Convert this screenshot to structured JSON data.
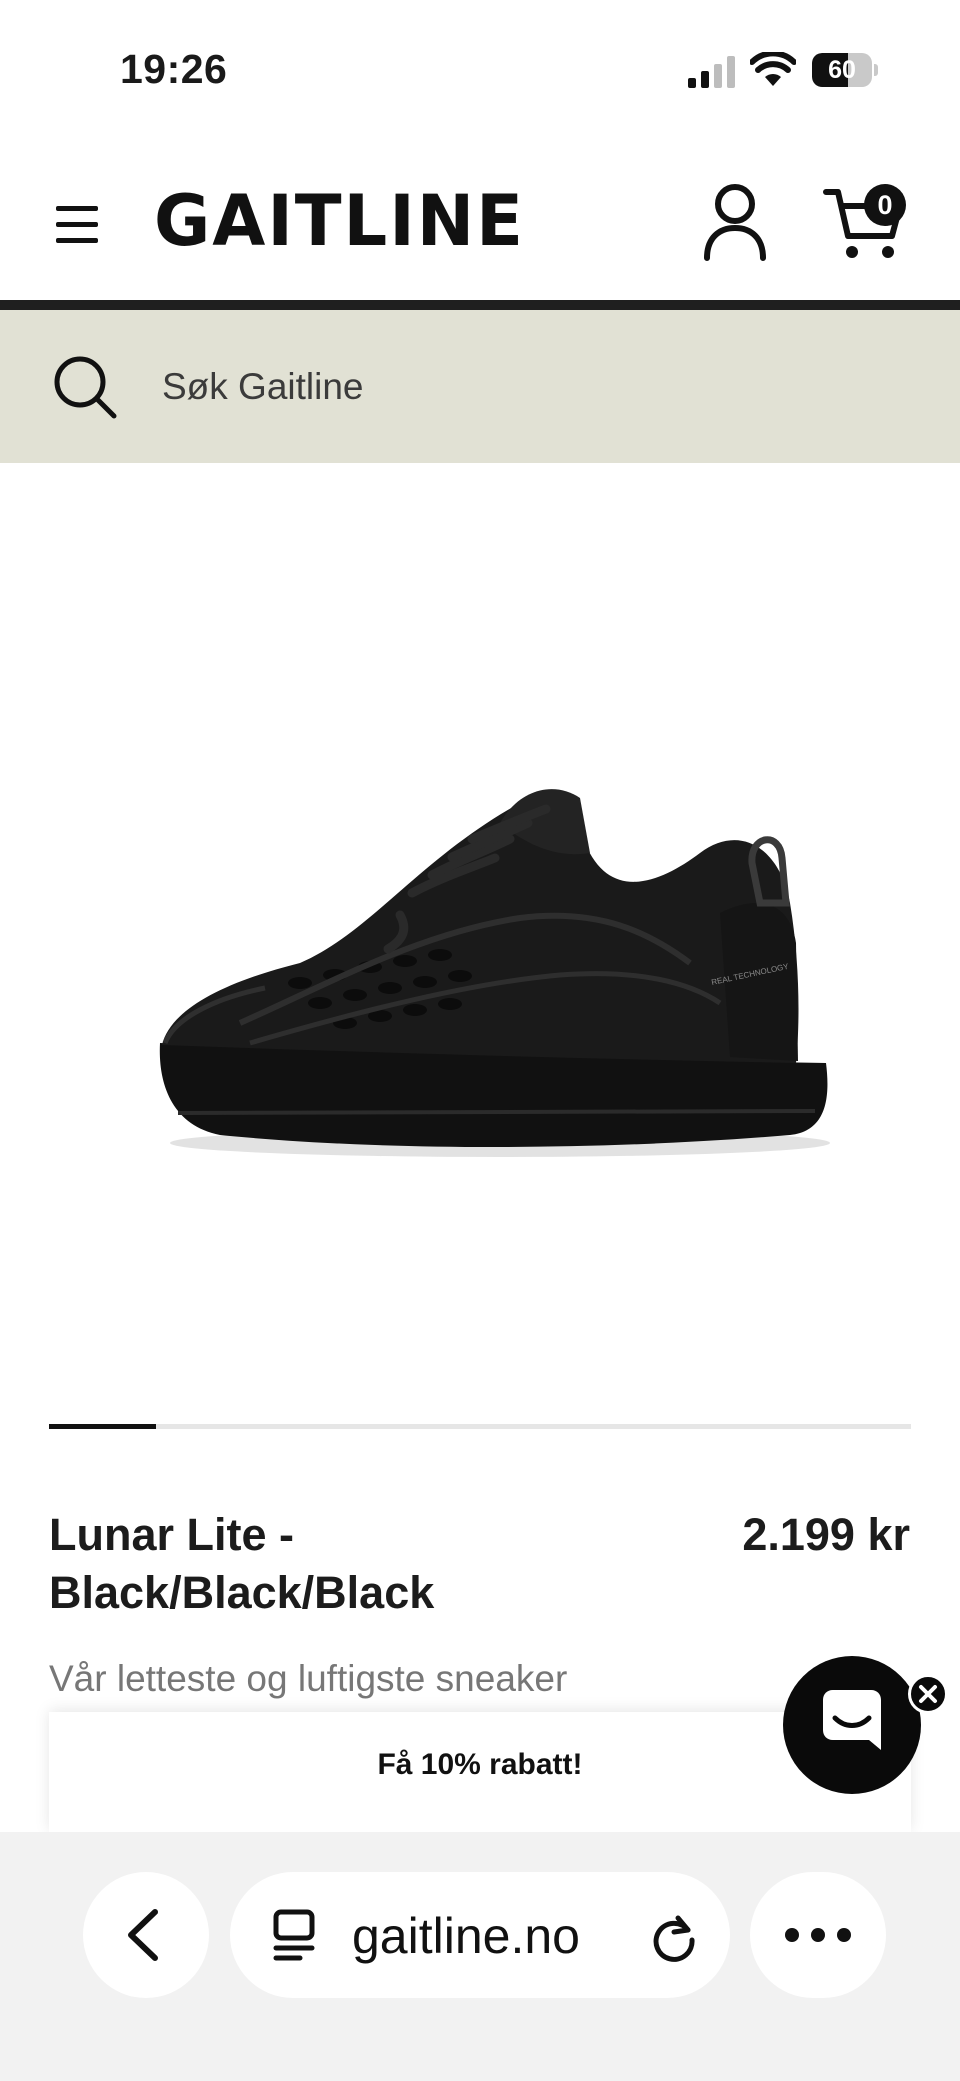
{
  "status_bar": {
    "time": "19:26",
    "battery_percent": "60",
    "battery_level": 0.6
  },
  "header": {
    "logo": "GAITLINE",
    "cart_count": "0"
  },
  "search": {
    "placeholder": "Søk Gaitline"
  },
  "gallery": {
    "progress_fraction": 0.124
  },
  "product": {
    "title": "Lunar Lite - Black/Black/Black",
    "price": "2.199 kr",
    "tagline": "Vår letteste og luftigste sneaker",
    "heel_tab_print": "REAL TECHNOLOGY"
  },
  "discount_banner": {
    "label": "Få 10% rabatt!"
  },
  "browser": {
    "url": "gaitline.no"
  },
  "colors": {
    "search_background": "#e1e1d4",
    "header_divider": "#1f1f1f",
    "text_primary": "#1c1c1c",
    "text_muted": "#777777",
    "browser_toolbar": "#f2f2f2"
  },
  "icons": [
    "menu-icon",
    "account-icon",
    "cart-icon",
    "search-icon",
    "chat-icon",
    "close-icon",
    "chevron-left-icon",
    "tabs-icon",
    "reload-icon",
    "more-icon",
    "signal-icon",
    "wifi-icon",
    "battery-icon"
  ]
}
